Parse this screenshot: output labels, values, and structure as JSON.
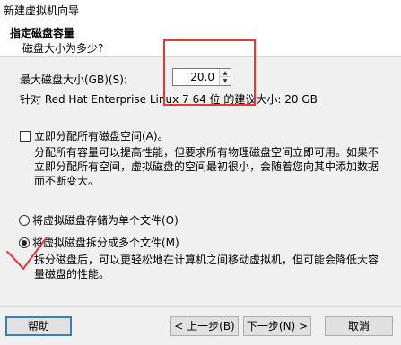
{
  "window": {
    "title": "新建虚拟机向导"
  },
  "header": {
    "title": "指定磁盘容量",
    "subtitle": "磁盘大小为多少?"
  },
  "disk_size": {
    "label": "最大磁盘大小(GB)(S):",
    "value": "20.0",
    "recommendation": "针对 Red Hat Enterprise Linux 7 64 位 的建议大小: 20 GB"
  },
  "allocate": {
    "checkbox_label": "立即分配所有磁盘空间(A)。",
    "checked": false,
    "description": "分配所有容量可以提高性能，但要求所有物理磁盘空间立即可用。如果不立即分配所有空间，虚拟磁盘的空间最初很小，会随着您向其中添加数据而不断变大。"
  },
  "storage": {
    "single_file_label": "将虚拟磁盘存储为单个文件(O)",
    "multi_file_label": "将虚拟磁盘拆分成多个文件(M)",
    "selected": "multi",
    "multi_file_description": "拆分磁盘后，可以更轻松地在计算机之间移动虚拟机，但可能会降低大容量磁盘的性能。"
  },
  "footer": {
    "help_label": "帮助",
    "back_label": "< 上一步(B)",
    "next_label": "下一步(N) >",
    "cancel_label": "取消"
  },
  "annotations": {
    "highlight_color": "#e53935",
    "check_mark_color": "#e53935"
  }
}
